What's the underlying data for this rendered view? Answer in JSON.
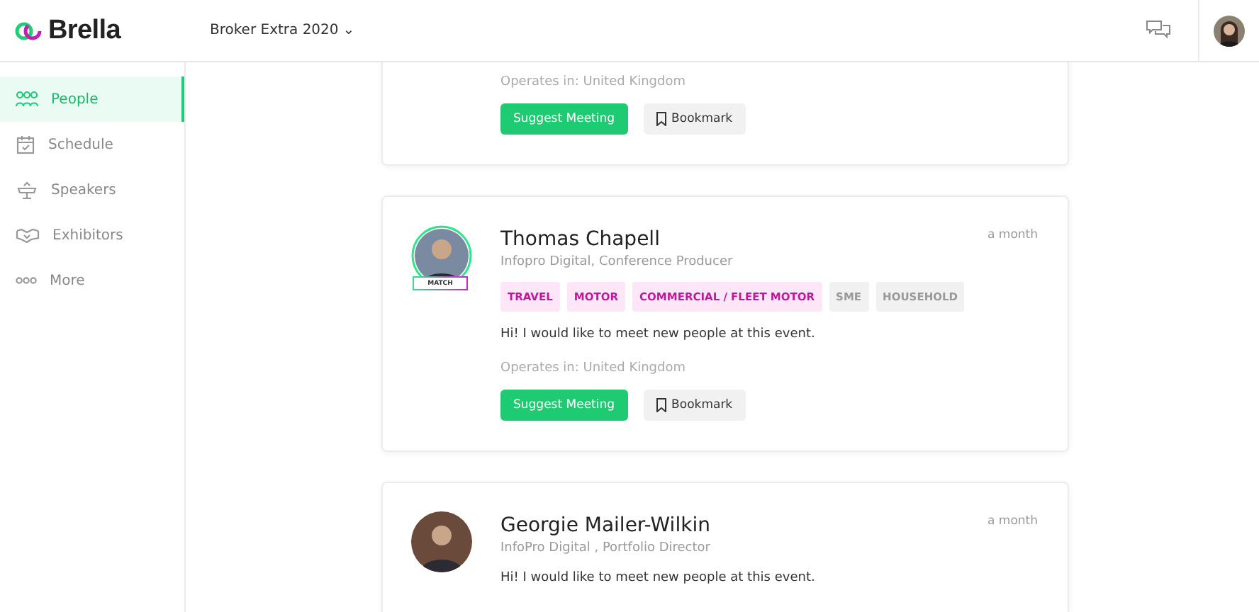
{
  "header": {
    "logo": "Brella",
    "event": "Broker Extra 2020",
    "caret": "⌄"
  },
  "sidebar": {
    "items": [
      {
        "kind": "people",
        "label": "People",
        "selected": true
      },
      {
        "kind": "schedule",
        "label": "Schedule",
        "selected": false
      },
      {
        "kind": "speakers",
        "label": "Speakers",
        "selected": false
      },
      {
        "kind": "exhibitors",
        "label": "Exhibitors",
        "selected": false
      },
      {
        "kind": "more",
        "label": "More",
        "selected": false
      }
    ]
  },
  "cards": [
    {
      "operates": "Operates in: United Kingdom",
      "buttons": [
        "Suggest Meeting",
        "Bookmark"
      ]
    },
    {
      "name": "Thomas Chapell",
      "role": "Infopro Digital, Conference Producer",
      "time": "a month",
      "match": "MATCH",
      "tags": [
        {
          "label": "TRAVEL",
          "matched": true
        },
        {
          "label": "MOTOR",
          "matched": true
        },
        {
          "label": "COMMERCIAL / FLEET MOTOR",
          "matched": true
        },
        {
          "label": "SME",
          "matched": false
        },
        {
          "label": "HOUSEHOLD",
          "matched": false
        }
      ],
      "message": "Hi! I would like to meet new people at this event.",
      "operates": "Operates in: United Kingdom",
      "buttons": [
        "Suggest Meeting",
        "Bookmark"
      ]
    },
    {
      "name": "Georgie Mailer-Wilkin",
      "role": "InfoPro Digital , Portfolio Director",
      "time": "a month",
      "message": "Hi! I would like to meet new people at this event."
    }
  ]
}
